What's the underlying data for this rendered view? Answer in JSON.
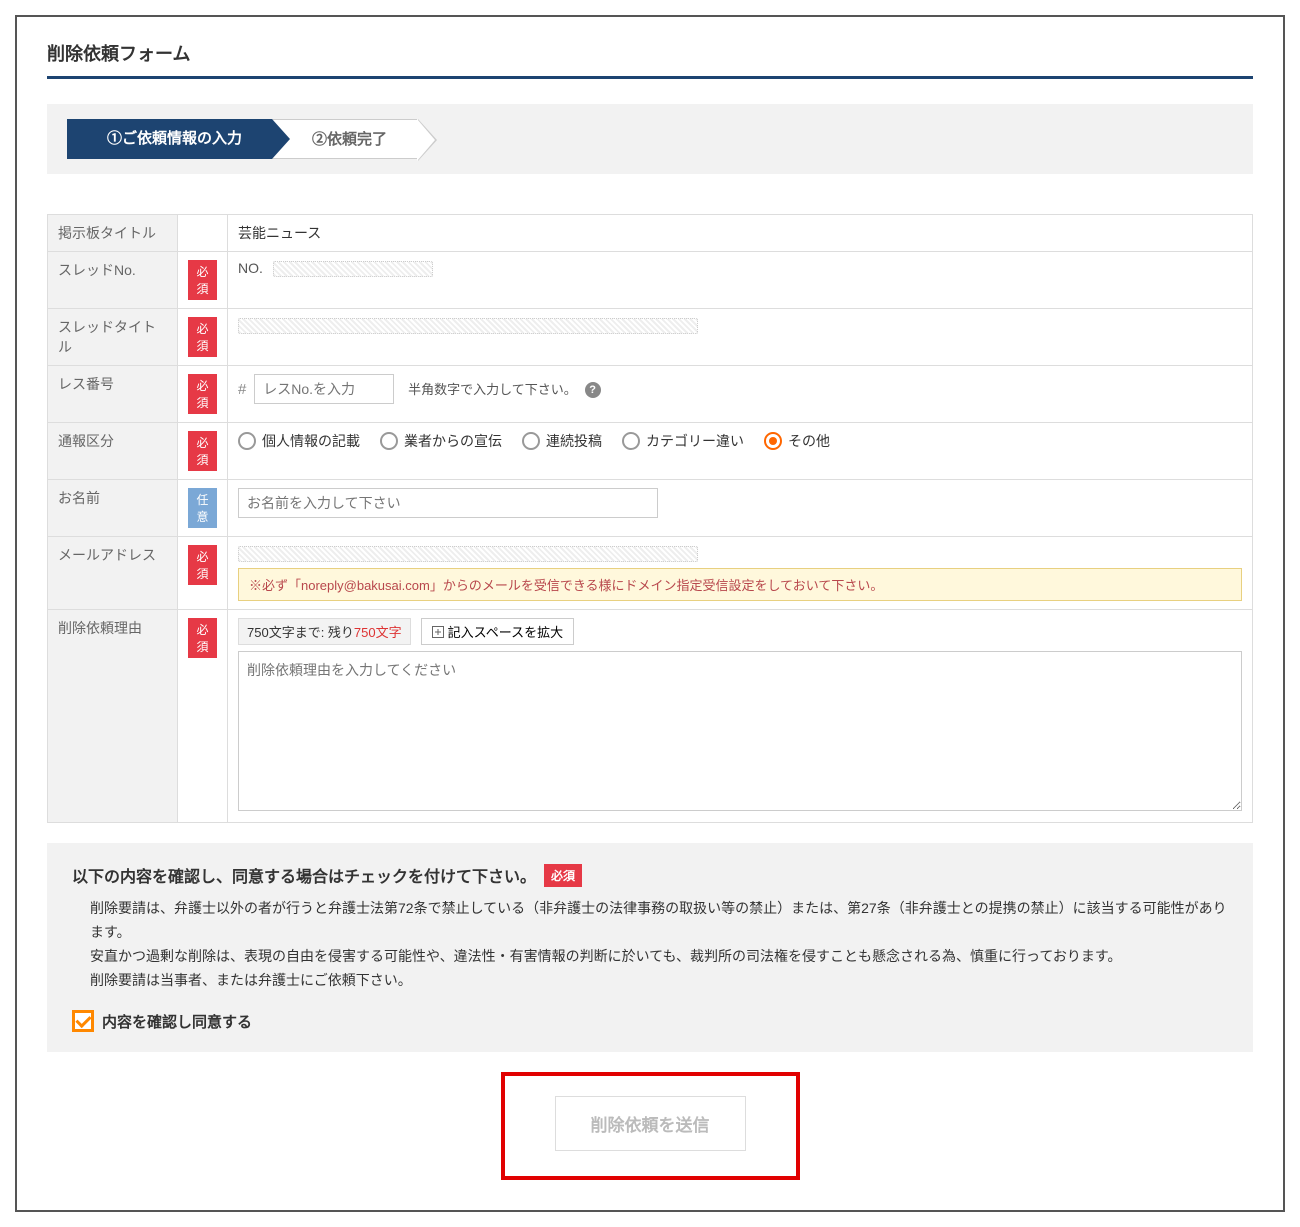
{
  "page": {
    "title": "削除依頼フォーム"
  },
  "steps": {
    "step1": "①ご依頼情報の入力",
    "step2": "②依頼完了"
  },
  "badges": {
    "required": "必須",
    "optional": "任意"
  },
  "labels": {
    "board_title": "掲示板タイトル",
    "thread_no": "スレッドNo.",
    "thread_title": "スレッドタイトル",
    "res_no": "レス番号",
    "report_type": "通報区分",
    "name": "お名前",
    "email": "メールアドレス",
    "reason": "削除依頼理由"
  },
  "values": {
    "board_title": "芸能ニュース",
    "thread_no_prefix": "NO.",
    "res_hash": "#",
    "res_placeholder": "レスNo.を入力",
    "res_hint": "半角数字で入力して下さい。",
    "name_placeholder": "お名前を入力して下さい",
    "email_note": "※必ず「noreply@bakusai.com」からのメールを受信できる様にドメイン指定受信設定をしておいて下さい。",
    "char_count_prefix": "750文字まで: 残り",
    "char_count_value": "750文字",
    "expand_label": "記入スペースを拡大",
    "reason_placeholder": "削除依頼理由を入力してください"
  },
  "report_options": [
    {
      "label": "個人情報の記載",
      "checked": false
    },
    {
      "label": "業者からの宣伝",
      "checked": false
    },
    {
      "label": "連続投稿",
      "checked": false
    },
    {
      "label": "カテゴリー違い",
      "checked": false
    },
    {
      "label": "その他",
      "checked": true
    }
  ],
  "agreement": {
    "header": "以下の内容を確認し、同意する場合はチェックを付けて下さい。",
    "body": "削除要請は、弁護士以外の者が行うと弁護士法第72条で禁止している（非弁護士の法律事務の取扱い等の禁止）または、第27条（非弁護士との提携の禁止）に該当する可能性があります。\n安直かつ過剰な削除は、表現の自由を侵害する可能性や、違法性・有害情報の判断に於いても、裁判所の司法権を侵すことも懸念される為、慎重に行っております。\n削除要請は当事者、または弁護士にご依頼下さい。",
    "checkbox_label": "内容を確認し同意する"
  },
  "submit": {
    "label": "削除依頼を送信"
  }
}
